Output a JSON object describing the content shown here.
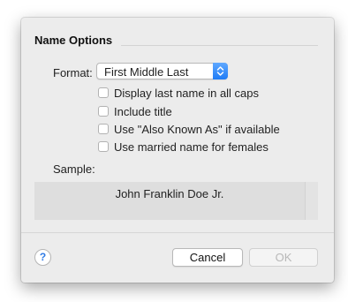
{
  "dialog": {
    "section_title": "Name Options",
    "format": {
      "label": "Format:",
      "selected": "First Middle Last"
    },
    "options": [
      {
        "label": "Display last name in all caps",
        "checked": false
      },
      {
        "label": "Include title",
        "checked": false
      },
      {
        "label": "Use \"Also Known As\" if available",
        "checked": false
      },
      {
        "label": "Use married name for females",
        "checked": false
      }
    ],
    "sample": {
      "label": "Sample:",
      "text": "John Franklin Doe Jr."
    },
    "buttons": {
      "help": "?",
      "cancel": "Cancel",
      "ok": "OK"
    }
  },
  "colors": {
    "dialog_bg": "#ececec",
    "accent": "#1f7cf6",
    "disabled_text": "#b8b8b8"
  }
}
